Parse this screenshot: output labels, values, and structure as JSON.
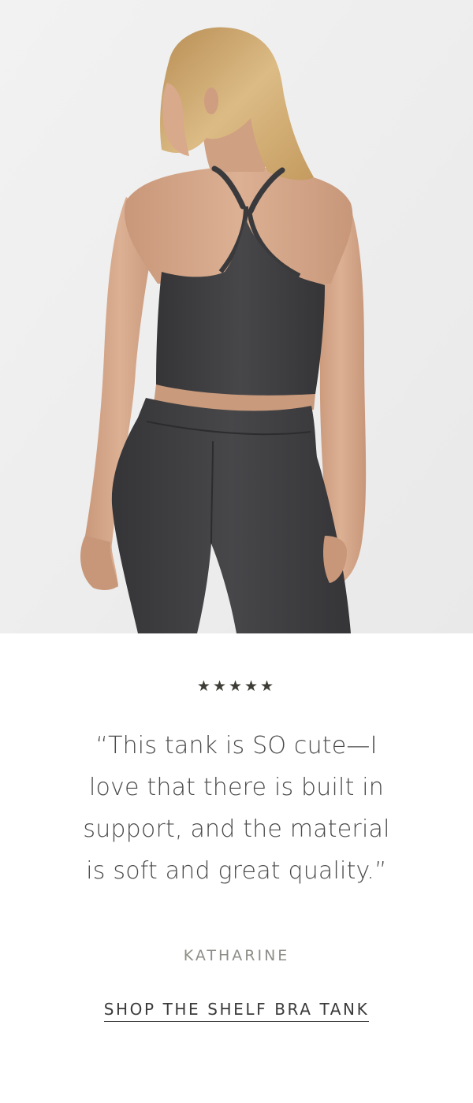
{
  "hero": {
    "image_icon": "model-photo",
    "background_color": "#efefef",
    "garment_color": "#3f3f41",
    "skin_color": "#d9ab8c",
    "hair_color": "#d2ae74"
  },
  "review": {
    "stars_icon": "five-star-rating",
    "stars_text": "★★★★★",
    "rating": 5,
    "quote_text": "“This tank is SO cute—I love that there is built in support, and the material is soft and great quality.”",
    "reviewer_name": "KATHARINE",
    "cta_label": "SHOP THE SHELF BRA TANK"
  }
}
